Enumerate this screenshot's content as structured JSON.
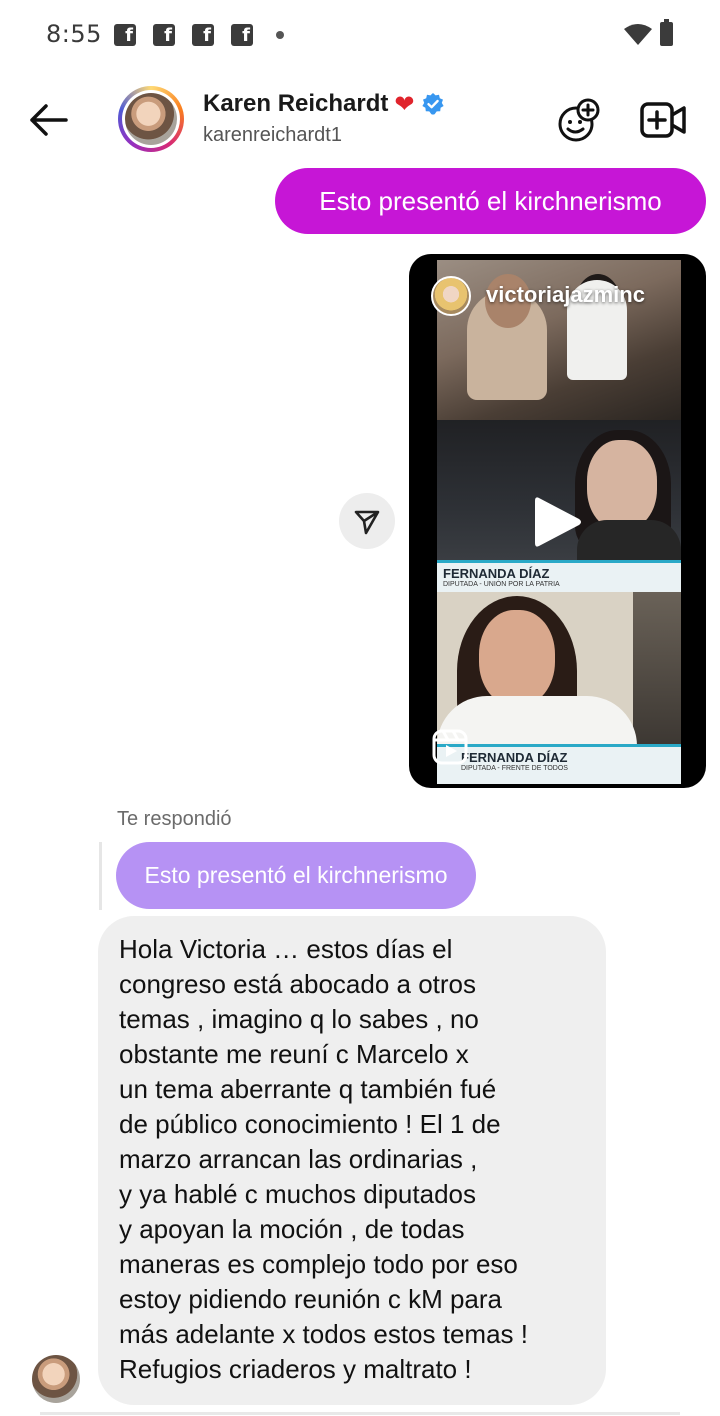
{
  "status_bar": {
    "time": "8:55",
    "notification_icons": [
      "facebook-icon",
      "facebook-icon",
      "facebook-icon",
      "facebook-icon"
    ],
    "fb_glyph": "f"
  },
  "header": {
    "contact_name": "Karen Reichardt",
    "heart_emoji": "❤",
    "username": "karenreichardt1",
    "verified": true
  },
  "messages": {
    "outgoing_text": "Esto presentó el kirchnerismo",
    "reel": {
      "username": "victoriajazminc",
      "caption1_name": "FERNANDA DÍAZ",
      "caption1_sub": "DIPUTADA - UNIÓN POR LA PATRIA",
      "caption2_name": "FERNANDA DÍAZ",
      "caption2_sub": "DIPUTADA - FRENTE DE TODOS"
    },
    "reply_label": "Te respondió",
    "quoted_text": "Esto presentó el kirchnerismo",
    "incoming_lines": [
      "Hola Victoria … estos días el",
      "congreso está abocado a otros",
      "temas , imagino q lo sabes , no",
      "obstante me reuní c Marcelo x",
      "un tema aberrante q también fué",
      "de público conocimiento ! El 1 de",
      "marzo arrancan las ordinarias ,",
      "y ya hablé c muchos diputados",
      "y apoyan la moción , de todas",
      "maneras es complejo todo por eso",
      "estoy pidiendo reunión c kM para",
      "más adelante x todos estos temas !",
      "Refugios criaderos y maltrato !"
    ]
  },
  "colors": {
    "outgoing_bubble": "#c616d6",
    "quoted_bubble": "#b692f4",
    "incoming_bubble": "#efefef",
    "verified_badge": "#3897f0",
    "heart": "#e0242c"
  }
}
